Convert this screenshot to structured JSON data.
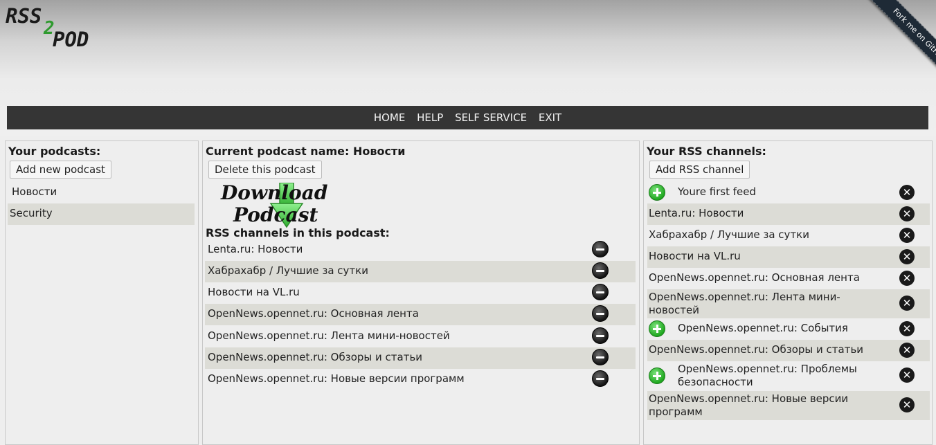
{
  "logo": {
    "part1": "RSS",
    "part2": "2",
    "part3": "POD"
  },
  "ribbon": {
    "label": "Fork me on GitHub"
  },
  "nav": {
    "items": [
      "HOME",
      "HELP",
      "SELF SERVICE",
      "EXIT"
    ]
  },
  "left": {
    "title": "Your podcasts:",
    "add_button": "Add new podcast",
    "podcasts": [
      "Новости",
      "Security"
    ]
  },
  "middle": {
    "title_prefix": "Current podcast name:",
    "podcast_name": "Новости",
    "delete_button": "Delete this podcast",
    "download_line1": "Download",
    "download_line2": "Podcast",
    "channels_title": "RSS channels in this podcast:",
    "channels": [
      "Lenta.ru: Новости",
      "Хабрахабр / Лучшие за сутки",
      "Новости на VL.ru",
      "OpenNews.opennet.ru: Основная лента",
      "OpenNews.opennet.ru: Лента мини-новостей",
      "OpenNews.opennet.ru: Обзоры и статьи",
      "OpenNews.opennet.ru: Новые версии программ"
    ]
  },
  "right": {
    "title": "Your RSS channels:",
    "add_button": "Add RSS channel",
    "channels": [
      {
        "name": "Youre first feed",
        "can_add": true
      },
      {
        "name": "Lenta.ru: Новости",
        "can_add": false
      },
      {
        "name": "Хабрахабр / Лучшие за сутки",
        "can_add": false
      },
      {
        "name": "Новости на VL.ru",
        "can_add": false
      },
      {
        "name": "OpenNews.opennet.ru: Основная лента",
        "can_add": false
      },
      {
        "name": "OpenNews.opennet.ru: Лента мини-новостей",
        "can_add": false
      },
      {
        "name": "OpenNews.opennet.ru: События",
        "can_add": true
      },
      {
        "name": "OpenNews.opennet.ru: Обзоры и статьи",
        "can_add": false
      },
      {
        "name": "OpenNews.opennet.ru: Проблемы безопасности",
        "can_add": true
      },
      {
        "name": "OpenNews.opennet.ru: Новые версии программ",
        "can_add": false
      }
    ]
  },
  "icons": {
    "remove": "minus-circle-icon",
    "delete": "close-circle-icon",
    "add": "plus-circle-icon",
    "download": "download-arrow-icon"
  }
}
